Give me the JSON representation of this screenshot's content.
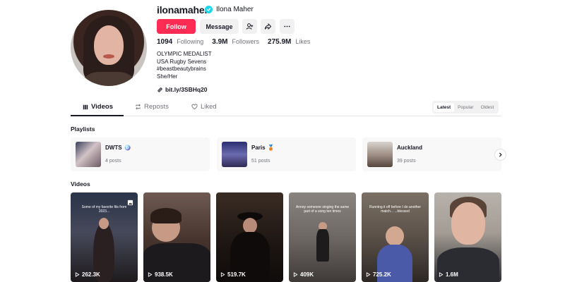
{
  "profile": {
    "username": "ilonamaher",
    "display_name": "Ilona Maher",
    "follow_label": "Follow",
    "message_label": "Message",
    "stats": {
      "following_count": "1094",
      "following_label": "Following",
      "followers_count": "3.9M",
      "followers_label": "Followers",
      "likes_count": "275.9M",
      "likes_label": "Likes"
    },
    "bio": {
      "line1": "OLYMPIC MEDALIST",
      "line2": "USA Rugby Sevens",
      "line3": "#beastbeautybrains",
      "line4": "She/Her"
    },
    "link": "bit.ly/3SBHq20"
  },
  "tabs": [
    {
      "label": "Videos",
      "icon": "grid-icon",
      "active": true
    },
    {
      "label": "Reposts",
      "icon": "repost-icon",
      "active": false
    },
    {
      "label": "Liked",
      "icon": "heart-outline-icon",
      "active": false
    }
  ],
  "sort": [
    "Latest",
    "Popular",
    "Oldest"
  ],
  "playlists_title": "Playlists",
  "playlists": [
    {
      "name": "DWTS",
      "emoji": "🪩",
      "count": "4 posts"
    },
    {
      "name": "Paris",
      "emoji": "🥉",
      "count": "51 posts"
    },
    {
      "name": "Auckland",
      "emoji": "",
      "count": "39 posts"
    }
  ],
  "videos_title": "Videos",
  "videos": [
    {
      "views": "262.3K",
      "caption": "Some of my favorite fits from 2023..."
    },
    {
      "views": "938.5K",
      "caption": ""
    },
    {
      "views": "519.7K",
      "caption": ""
    },
    {
      "views": "409K",
      "caption": "Annoy someone singing the same part of a song ten times"
    },
    {
      "views": "725.2K",
      "caption": "Running it off before I do another match... ...blessed"
    },
    {
      "views": "1.6M",
      "caption": ""
    }
  ],
  "colors": {
    "follow_bg": "#fe2c55",
    "verified": "#20d5ec",
    "text": "#161823",
    "muted": "#73757c"
  }
}
